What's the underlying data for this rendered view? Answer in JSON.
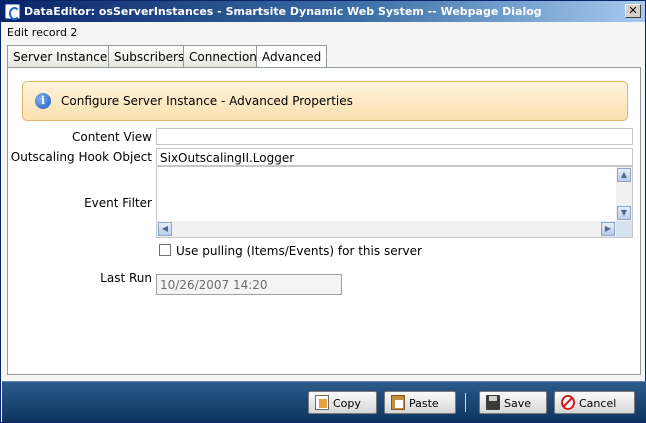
{
  "window": {
    "title": "DataEditor: osServerInstances - Smartsite Dynamic Web System -- Webpage Dialog",
    "close_glyph": "✕"
  },
  "record": {
    "label": "Edit record 2"
  },
  "tabs": [
    {
      "label": "Server Instance",
      "active": false
    },
    {
      "label": "Subscribers",
      "active": false
    },
    {
      "label": "Connection",
      "active": false
    },
    {
      "label": "Advanced",
      "active": true
    }
  ],
  "info": {
    "icon": "info-icon",
    "glyph": "i",
    "text": "Configure Server Instance - Advanced Properties"
  },
  "form": {
    "content_view": {
      "label": "Content View",
      "value": ""
    },
    "outscaling_hook": {
      "label": "Outscaling Hook Object",
      "value": "SixOutscalingII.Logger"
    },
    "event_filter": {
      "label": "Event Filter",
      "value": ""
    },
    "use_pulling": {
      "label": "Use pulling (Items/Events) for this server",
      "checked": false
    },
    "last_run": {
      "label": "Last Run",
      "value": "10/26/2007 14:20"
    }
  },
  "buttons": {
    "copy": "Copy",
    "paste": "Paste",
    "save": "Save",
    "cancel": "Cancel"
  },
  "colors": {
    "titlebar": "#0a246a",
    "footer": "#1f4a78",
    "info_bg": "#fbe0b0"
  }
}
